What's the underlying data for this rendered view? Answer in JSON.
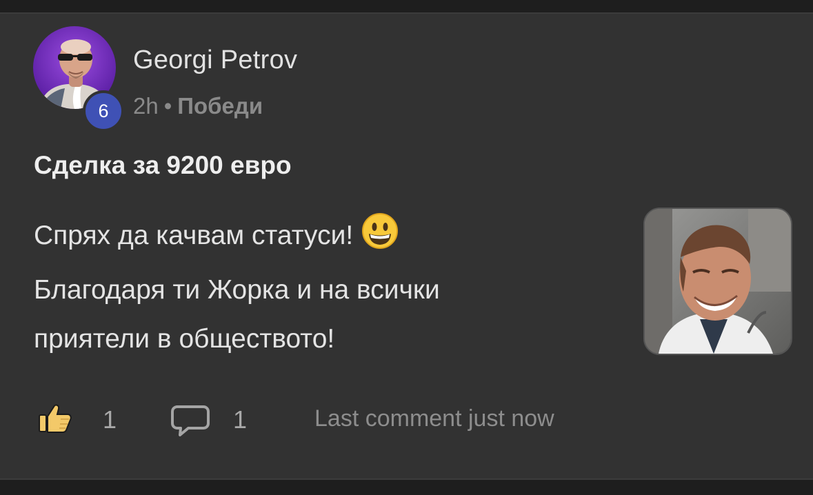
{
  "post": {
    "author": "Georgi Petrov",
    "level": "6",
    "time": "2h",
    "separator": "•",
    "category": "Победи",
    "title": "Сделка за 9200 евро",
    "body": {
      "line1": "Спрях да качвам статуси!",
      "line2": "Благодаря ти Жорка и на всички",
      "line3": "приятели в обществото!"
    },
    "emoji": "grinning-face-emoji"
  },
  "actions": {
    "likes": "1",
    "comments": "1",
    "last_comment": "Last comment just now"
  },
  "colors": {
    "card_background": "#323232",
    "level_badge": "#3f51b5",
    "avatar_background": "#7b2fbe",
    "like_icon_fill": "#f3c969"
  }
}
